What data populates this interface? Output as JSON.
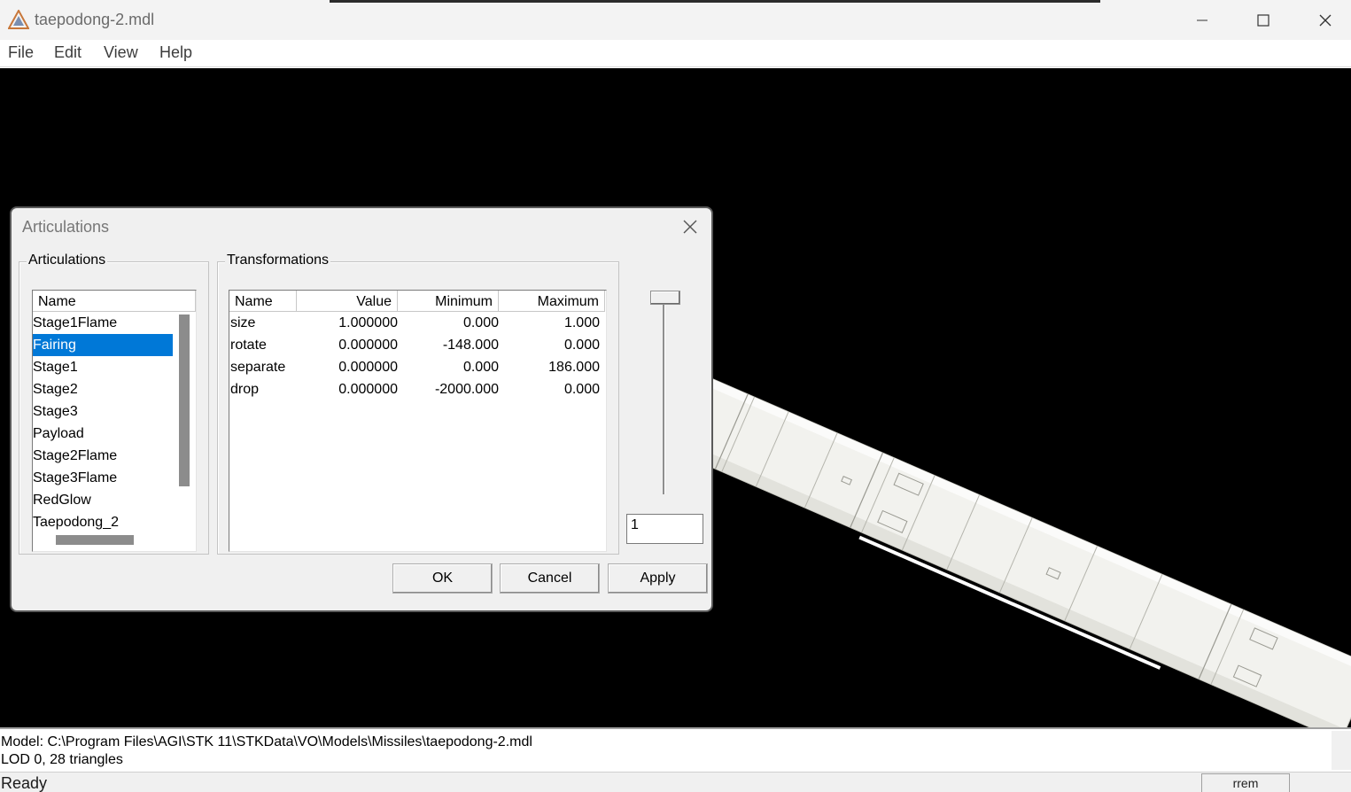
{
  "window": {
    "title": "taepodong-2.mdl"
  },
  "menu": [
    "File",
    "Edit",
    "View",
    "Help"
  ],
  "dialog": {
    "title": "Articulations",
    "articulations_group": "Articulations",
    "transformations_group": "Transformations",
    "articulations_header": "Name",
    "articulations": [
      "Stage1Flame",
      "Fairing",
      "Stage1",
      "Stage2",
      "Stage3",
      "Payload",
      "Stage2Flame",
      "Stage3Flame",
      "RedGlow",
      "Taepodong_2"
    ],
    "selected_articulation": "Fairing",
    "transform_headers": [
      "Name",
      "Value",
      "Minimum",
      "Maximum"
    ],
    "transformations": [
      {
        "name": "size",
        "value": "1.000000",
        "min": "0.000",
        "max": "1.000"
      },
      {
        "name": "rotate",
        "value": "0.000000",
        "min": "-148.000",
        "max": "0.000"
      },
      {
        "name": "separate",
        "value": "0.000000",
        "min": "0.000",
        "max": "186.000"
      },
      {
        "name": "drop",
        "value": "0.000000",
        "min": "-2000.000",
        "max": "0.000"
      }
    ],
    "slider_value": "1",
    "buttons": {
      "ok": "OK",
      "cancel": "Cancel",
      "apply": "Apply"
    }
  },
  "status": {
    "model_path": "Model:  C:\\Program Files\\AGI\\STK 11\\STKData\\VO\\Models\\Missiles\\taepodong-2.mdl",
    "lod": "LOD 0, 28 triangles",
    "ready": "Ready",
    "indicator": "rrem"
  },
  "icons": {
    "app": "app-triangle-icon",
    "minimize": "minimize-icon",
    "maximize": "maximize-icon",
    "close": "close-icon"
  },
  "colors": {
    "selection": "#0078d7",
    "viewport": "#000000",
    "missile": "#f4f4f0"
  }
}
